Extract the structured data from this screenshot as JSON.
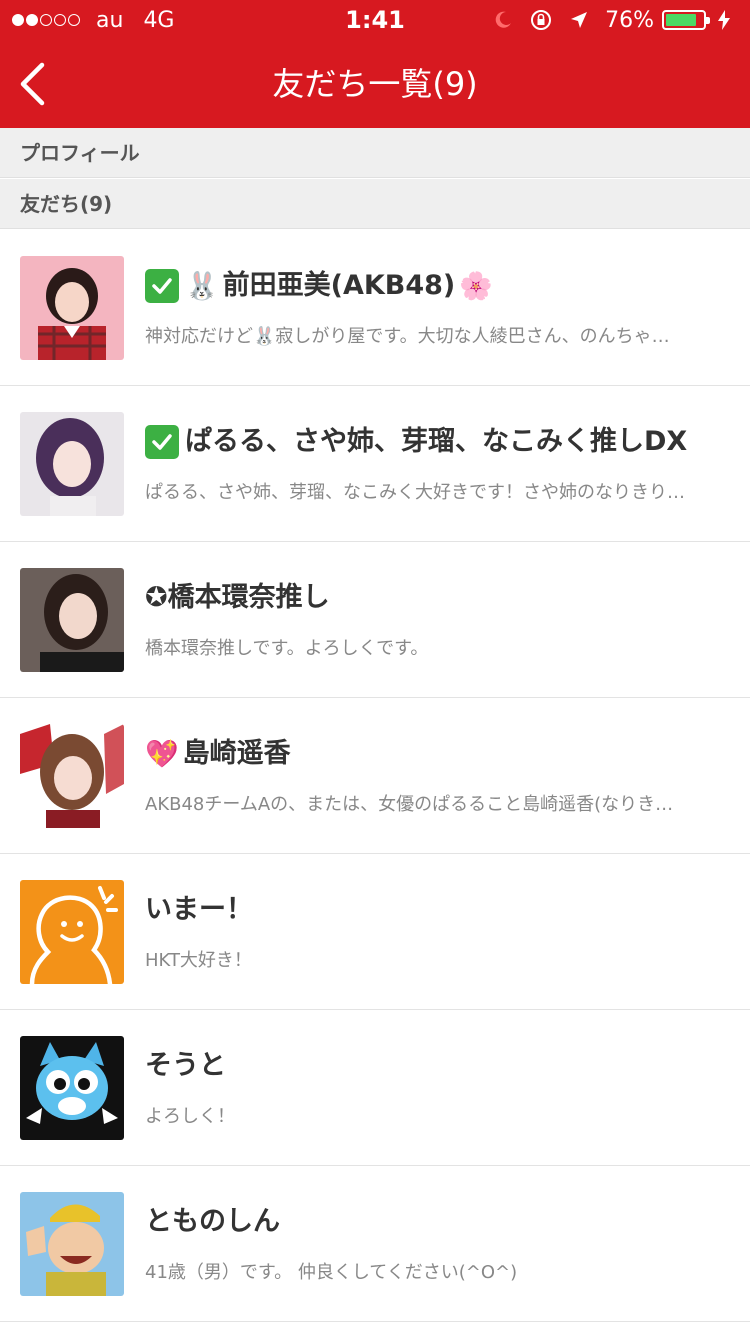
{
  "status_bar": {
    "carrier": "au",
    "network": "4G",
    "time": "1:41",
    "battery": "76%",
    "signal_dots": [
      true,
      true,
      false,
      false,
      false
    ]
  },
  "nav": {
    "title": "友だち一覧(9)",
    "back_icon": "chevron-left-icon"
  },
  "sections": {
    "profile": "プロフィール",
    "friends": "友だち(9)"
  },
  "friends": [
    {
      "name": "前田亜美(AKB48)",
      "verified": true,
      "prefix_emoji": "🐰",
      "suffix_emoji": "🌸",
      "desc": "神対応だけど🐰寂しがり屋です。大切な人綾巴さん、のんちゃ…"
    },
    {
      "name": "ぱるる、さや姉、芽瑠、なこみく推しDX",
      "verified": true,
      "prefix_emoji": "",
      "suffix_emoji": "",
      "desc": "ぱるる、さや姉、芽瑠、なこみく大好きです！さや姉のなりきり…"
    },
    {
      "name": "✪橋本環奈推し",
      "verified": false,
      "prefix_emoji": "",
      "suffix_emoji": "",
      "desc": "橋本環奈推しです。よろしくです。"
    },
    {
      "name": "島崎遥香",
      "verified": false,
      "prefix_emoji": "💖",
      "suffix_emoji": "",
      "desc": "AKB48チームAの、または、女優のぱるること島崎遥香(なりき…"
    },
    {
      "name": "いまー！",
      "verified": false,
      "prefix_emoji": "",
      "suffix_emoji": "",
      "desc": "HKT大好き！"
    },
    {
      "name": "そうと",
      "verified": false,
      "prefix_emoji": "",
      "suffix_emoji": "",
      "desc": "よろしく！"
    },
    {
      "name": "とものしん",
      "verified": false,
      "prefix_emoji": "",
      "suffix_emoji": "",
      "desc": "41歳（男）です。 仲良くしてください(^O^)"
    }
  ],
  "colors": {
    "brand_red": "#d71920",
    "verified_green": "#3cb043",
    "battery_green": "#4cd964",
    "default_avatar_orange": "#f39218"
  }
}
